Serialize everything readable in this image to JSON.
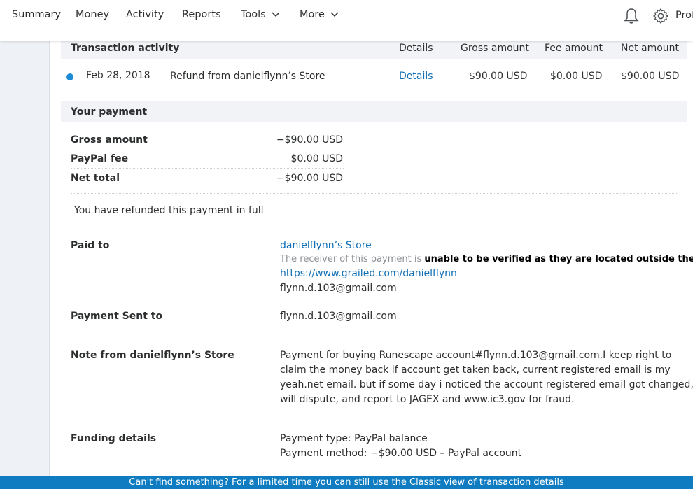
{
  "nav": {
    "items": [
      {
        "label": "Summary"
      },
      {
        "label": "Activity"
      },
      {
        "label": "Reports"
      },
      {
        "label": "Tools"
      },
      {
        "label": "More"
      },
      {
        "label": "Money"
      }
    ],
    "summary": "Summary",
    "money": "Money",
    "activity": "Activity",
    "reports": "Reports",
    "tools": "Tools",
    "more": "More",
    "profile_partial": "Prof"
  },
  "transaction": {
    "section_title": "Transaction activity",
    "columns": {
      "details": "Details",
      "gross": "Gross amount",
      "fee": "Fee amount",
      "net": "Net amount"
    },
    "row": {
      "date": "Feb 28, 2018",
      "description": "Refund from danielflynn’s Store",
      "details_link": "Details",
      "gross": "$90.00 USD",
      "fee": "$0.00 USD",
      "net": "$90.00 USD"
    }
  },
  "payment": {
    "section_title": "Your payment",
    "gross_label": "Gross amount",
    "gross_value": "−$90.00 USD",
    "fee_label": "PayPal fee",
    "fee_value": "$0.00 USD",
    "net_label": "Net total",
    "net_value": "−$90.00 USD",
    "refund_note": "You have refunded this payment in full"
  },
  "paid_to": {
    "label": "Paid to",
    "store_name": "danielflynn’s Store",
    "verify_prefix": "The receiver of this payment is ",
    "verify_bold": "unable to be verified as they are located outside the US",
    "verify_suffix": ".",
    "url": "https://www.grailed.com/danielflynn",
    "email": "flynn.d.103@gmail.com"
  },
  "sent_to": {
    "label": "Payment Sent to",
    "email": "flynn.d.103@gmail.com"
  },
  "note": {
    "label": "Note from danielflynn’s Store",
    "lines": [
      "Payment for buying Runescape account#flynn.d.103@gmail.com.I keep right to",
      "claim the money back if account get taken back, current registered email is my",
      "yeah.net email. but if some day i noticed the account registered email got changed, i",
      "will dispute, and report to JAGEX and www.ic3.gov for fraud."
    ]
  },
  "funding": {
    "label": "Funding details",
    "type": "Payment type: PayPal balance",
    "method": "Payment method: −$90.00 USD – PayPal account"
  },
  "banner": {
    "text": "Can't find something? For a limited time you can still use the ",
    "link": "Classic view of transaction details"
  },
  "colors": {
    "link": "#0e6fb5",
    "banner": "#0f7cc1",
    "status_dot": "#1c8bd6"
  }
}
